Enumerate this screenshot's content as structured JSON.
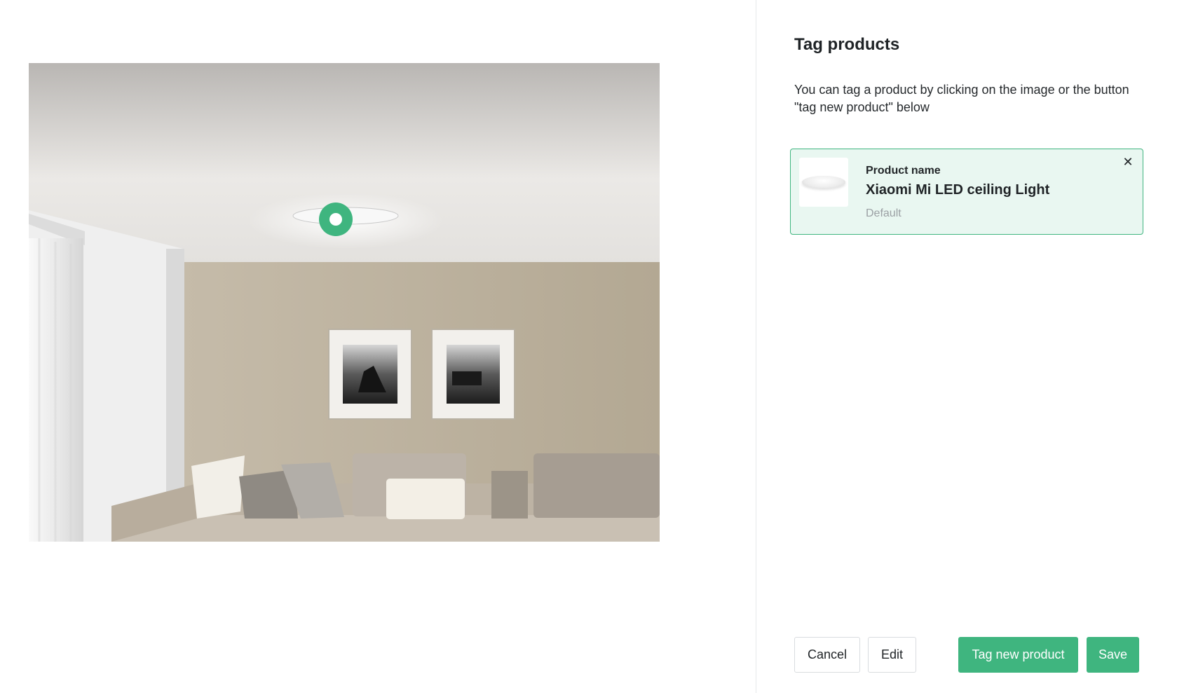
{
  "panel": {
    "title": "Tag products",
    "help_text": "You can tag a product by clicking on the image or the button \"tag new product\" below"
  },
  "tagged_product": {
    "label": "Product name",
    "name": "Xiaomi Mi LED ceiling Light",
    "variant": "Default",
    "remove_icon": "close-icon",
    "close_glyph": "✕"
  },
  "buttons": {
    "cancel": "Cancel",
    "edit": "Edit",
    "tag_new": "Tag new product",
    "save": "Save"
  },
  "colors": {
    "accent": "#3fb57f",
    "card_background": "#e9f7f1"
  }
}
